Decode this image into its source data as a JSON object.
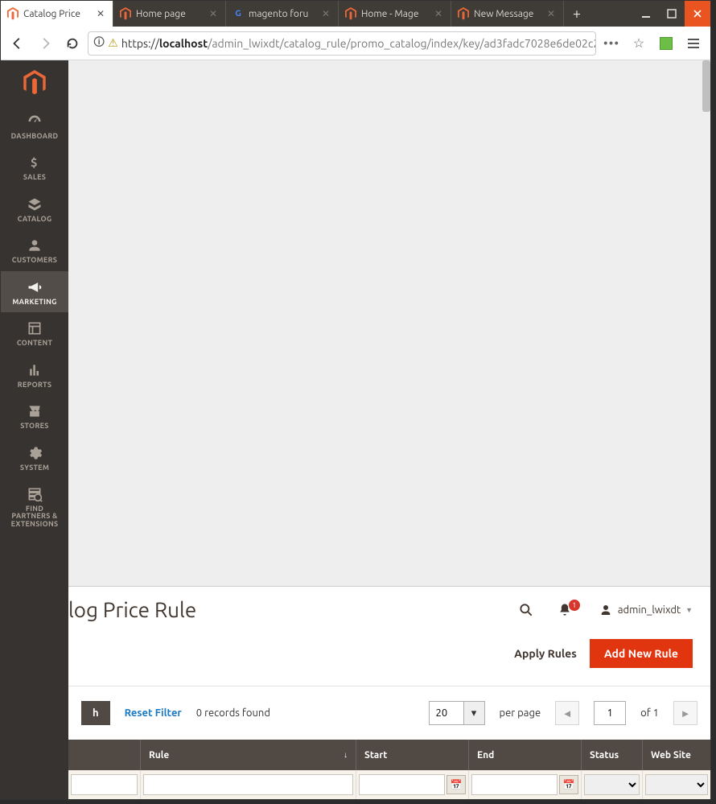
{
  "browser": {
    "tabs": [
      {
        "label": "Catalog Price",
        "icon": "magento"
      },
      {
        "label": "Home page",
        "icon": "magento"
      },
      {
        "label": "magento foru",
        "icon": "google"
      },
      {
        "label": "Home - Mage",
        "icon": "magento"
      },
      {
        "label": "New Message",
        "icon": "magento"
      }
    ],
    "url_prefix": "https://",
    "url_host": "localhost",
    "url_path": "/admin_lwixdt/catalog_rule/promo_catalog/index/key/ad3fadc7028e6de02c2"
  },
  "sidebar": {
    "items": [
      {
        "label": "DASHBOARD"
      },
      {
        "label": "SALES"
      },
      {
        "label": "CATALOG"
      },
      {
        "label": "CUSTOMERS"
      },
      {
        "label": "MARKETING"
      },
      {
        "label": "CONTENT"
      },
      {
        "label": "REPORTS"
      },
      {
        "label": "STORES"
      },
      {
        "label": "SYSTEM"
      },
      {
        "label": "FIND\nPARTNERS &\nEXTENSIONS"
      }
    ]
  },
  "page": {
    "title_visible": "log Price Rule",
    "notification_count": "1",
    "user": "admin_lwixdt",
    "actions": {
      "apply": "Apply Rules",
      "add": "Add New Rule"
    },
    "toolbar": {
      "search_btn": "h",
      "reset": "Reset Filter",
      "records": "0 records found",
      "page_size": "20",
      "per_page": "per page",
      "page_num": "1",
      "of_text": "of 1"
    },
    "columns": {
      "rule": "Rule",
      "start": "Start",
      "end": "End",
      "status": "Status",
      "website": "Web Site"
    }
  }
}
